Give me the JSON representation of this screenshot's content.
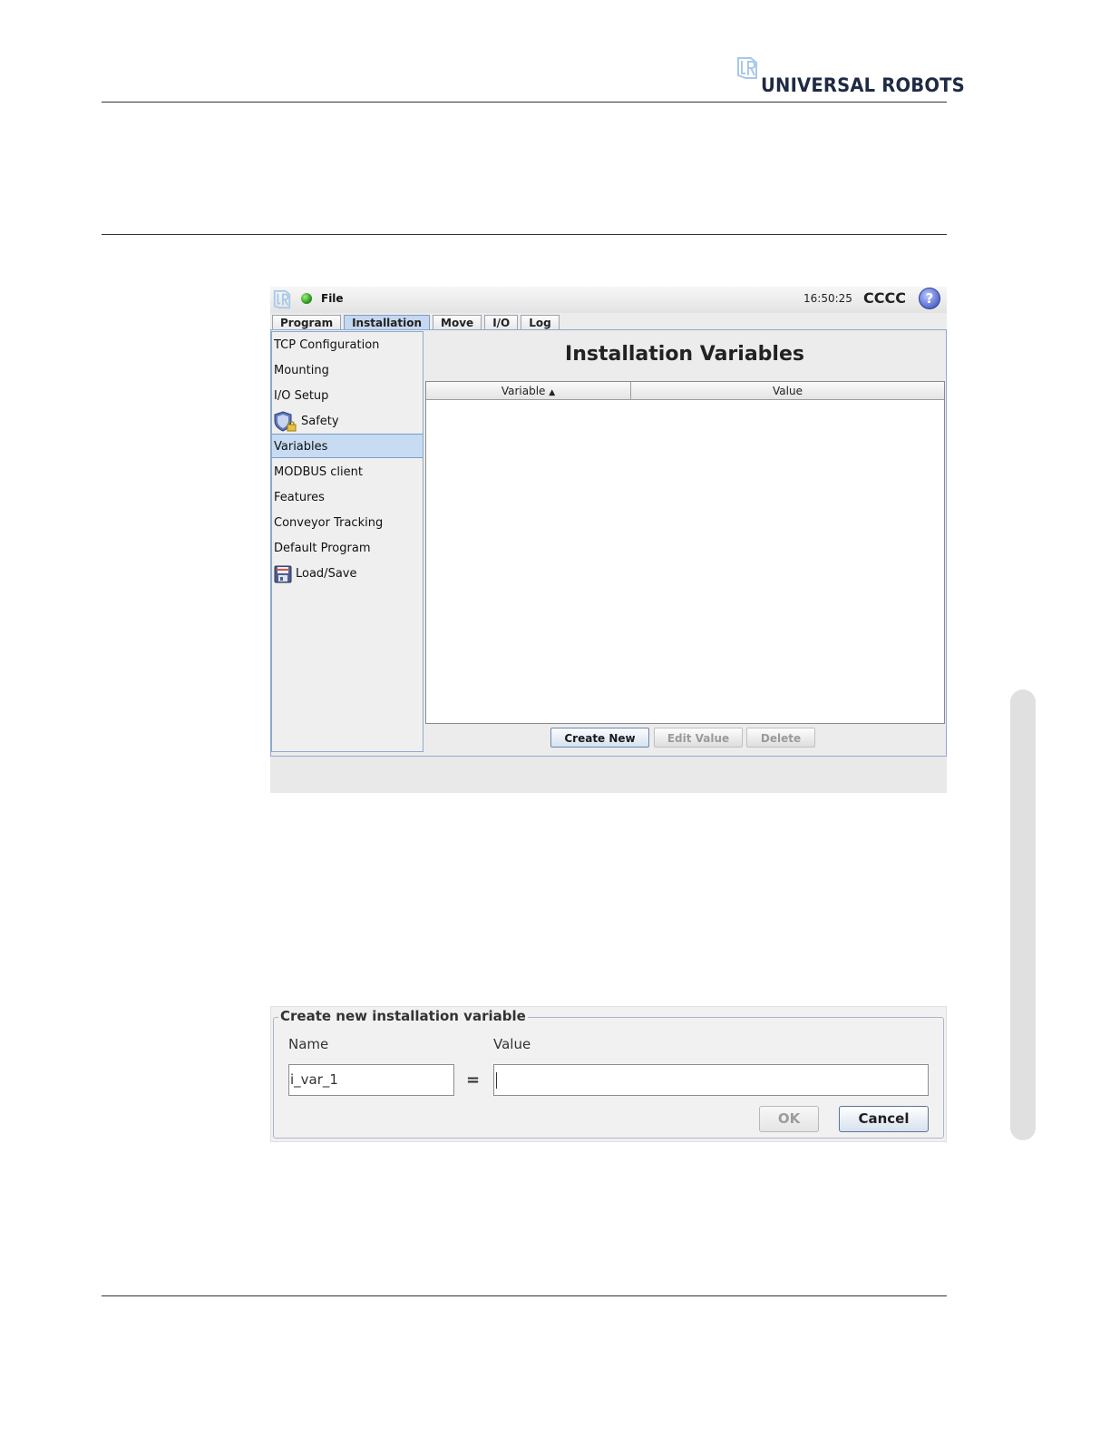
{
  "header": {
    "brand": "UNIVERSAL ROBOTS",
    "logo": "ur-logo-icon"
  },
  "app": {
    "menu_file": "File",
    "clock": "16:50:25",
    "robot_name": "CCCC",
    "help_label": "?",
    "tabs": [
      {
        "label": "Program",
        "active": false
      },
      {
        "label": "Installation",
        "active": true
      },
      {
        "label": "Move",
        "active": false
      },
      {
        "label": "I/O",
        "active": false
      },
      {
        "label": "Log",
        "active": false
      }
    ],
    "sidebar": [
      {
        "label": "TCP Configuration"
      },
      {
        "label": "Mounting"
      },
      {
        "label": "I/O Setup"
      },
      {
        "label": "Safety",
        "icon": "shield-lock-icon"
      },
      {
        "label": "Variables",
        "selected": true
      },
      {
        "label": "MODBUS client"
      },
      {
        "label": "Features"
      },
      {
        "label": "Conveyor Tracking"
      },
      {
        "label": "Default Program"
      },
      {
        "label": "Load/Save",
        "icon": "floppy-disk-icon"
      }
    ],
    "title": "Installation Variables",
    "table": {
      "columns": [
        "Variable",
        "Value"
      ],
      "sort_indicator": "▲",
      "rows": []
    },
    "buttons": {
      "create_new": "Create New",
      "edit_value": "Edit Value",
      "delete": "Delete"
    }
  },
  "dialog": {
    "title": "Create new installation variable",
    "name_label": "Name",
    "value_label": "Value",
    "name_value": "i_var_1",
    "value_value": "",
    "equals": "=",
    "ok_label": "OK",
    "cancel_label": "Cancel"
  },
  "colors": {
    "accent": "#c7dbf2",
    "brand": "#1f2a44",
    "border": "#8fa9cf"
  }
}
